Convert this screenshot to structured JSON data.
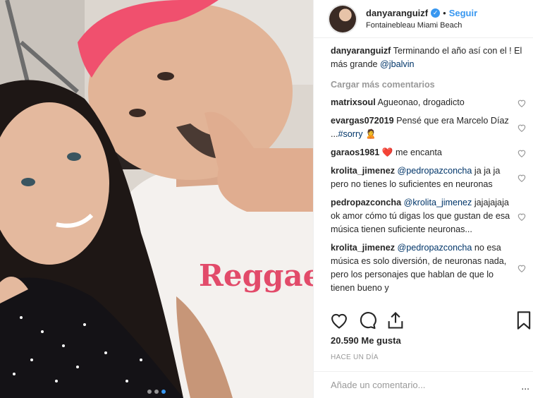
{
  "header": {
    "username": "danyaranguizf",
    "separator": "•",
    "follow_label": "Seguir",
    "location": "Fontainebleau Miami Beach"
  },
  "caption": {
    "username": "danyaranguizf",
    "text": " Terminando el año así con el ! El más grande ",
    "mention": "@jbalvin"
  },
  "load_more_label": "Cargar más comentarios",
  "comments": [
    {
      "username": "matrixsoul",
      "text": " Agueonao, drogadicto"
    },
    {
      "username": "evargas072019",
      "text": " Pensé que era Marcelo Díaz ...",
      "tag": "#sorry",
      "emoji": "🙎"
    },
    {
      "username": "garaos1981",
      "emoji": "❤️",
      "text": " me encanta"
    },
    {
      "username": "krolita_jimenez",
      "mention": "@pedropazconcha",
      "text": " ja ja ja pero no tienes lo suficientes en neuronas"
    },
    {
      "username": "pedropazconcha",
      "mention": "@krolita_jimenez",
      "text": " jajajajaja ok amor cómo tú digas los que gustan de esa música tienen suficiente neuronas..."
    },
    {
      "username": "krolita_jimenez",
      "mention": "@pedropazconcha",
      "text": " no esa música es solo diversión, de neuronas nada, pero los personajes que hablan de que lo tienen bueno y"
    }
  ],
  "likes_text": "20.590 Me gusta",
  "timestamp": "HACE UN DÍA",
  "add_comment_placeholder": "Añade un comentario...",
  "more_options": "...",
  "photo_text": "Reggae",
  "carousel": {
    "count": 3,
    "active": 3
  },
  "colors": {
    "accent": "#3897f0",
    "text": "#262626",
    "muted": "#999999",
    "heart": "#ed4956",
    "hair": "#f0506e"
  }
}
